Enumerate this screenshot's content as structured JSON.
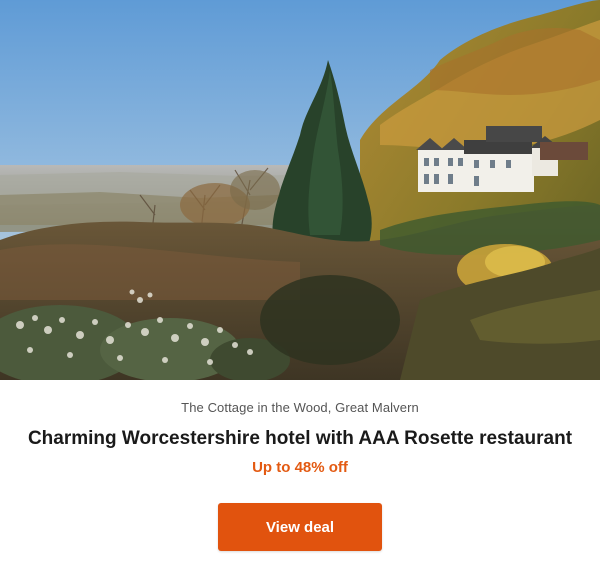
{
  "deal": {
    "image_subject": "Hillside hotel among autumn woodland overlooking a valley",
    "location": "The Cottage in the Wood, Great Malvern",
    "title": "Charming Worcestershire hotel with AAA Rosette restaurant",
    "discount": "Up to 48% off",
    "cta_label": "View deal"
  },
  "colors": {
    "accent": "#e1530e",
    "discount_text": "#e35a12",
    "title_text": "#1a1a1a",
    "location_text": "#555555"
  }
}
